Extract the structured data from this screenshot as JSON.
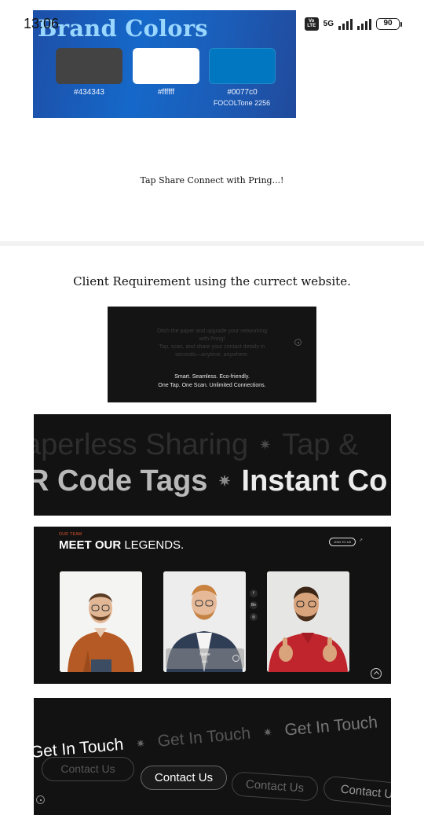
{
  "status_bar": {
    "time": "13:06",
    "network": "5G",
    "battery": "90"
  },
  "brand": {
    "title": "Brand Colors",
    "swatches": [
      {
        "label": "#434343",
        "color": "#434343"
      },
      {
        "label": "#ffffff",
        "color": "#ffffff"
      },
      {
        "label": "#0077c0",
        "sub": "FOCOLTone 2256",
        "color": "#0077c0"
      }
    ]
  },
  "tagline": "Tap Share Connect with Pring...!",
  "requirement": "Client Requirement using the currect website.",
  "hero": {
    "faded_lines": [
      "Ditch the paper and upgrade your networking",
      "with Pring!",
      "Tap, scan, and share your contact details in",
      "seconds—anytime, anywhere."
    ],
    "strong_lines": [
      "Smart. Seamless. Eco-friendly.",
      "One Tap. One Scan. Unlimited Connections."
    ]
  },
  "marquee": {
    "row1": [
      "aperless Sharing",
      "Tap &"
    ],
    "row2": [
      "R Code Tags",
      "Instant Co"
    ]
  },
  "team": {
    "eyebrow": "OUR TEAM",
    "title_bold": "MEET OUR",
    "title_light": " LEGENDS.",
    "join_label": "JOIN TO US",
    "social": [
      "f",
      "Be",
      "◎"
    ],
    "overlay_name": "Name",
    "overlay_role": "ABC"
  },
  "contact": {
    "get_in_touch": "Get In Touch",
    "contact_us": "Contact Us",
    "contact_ghost_right": "Contact U"
  }
}
